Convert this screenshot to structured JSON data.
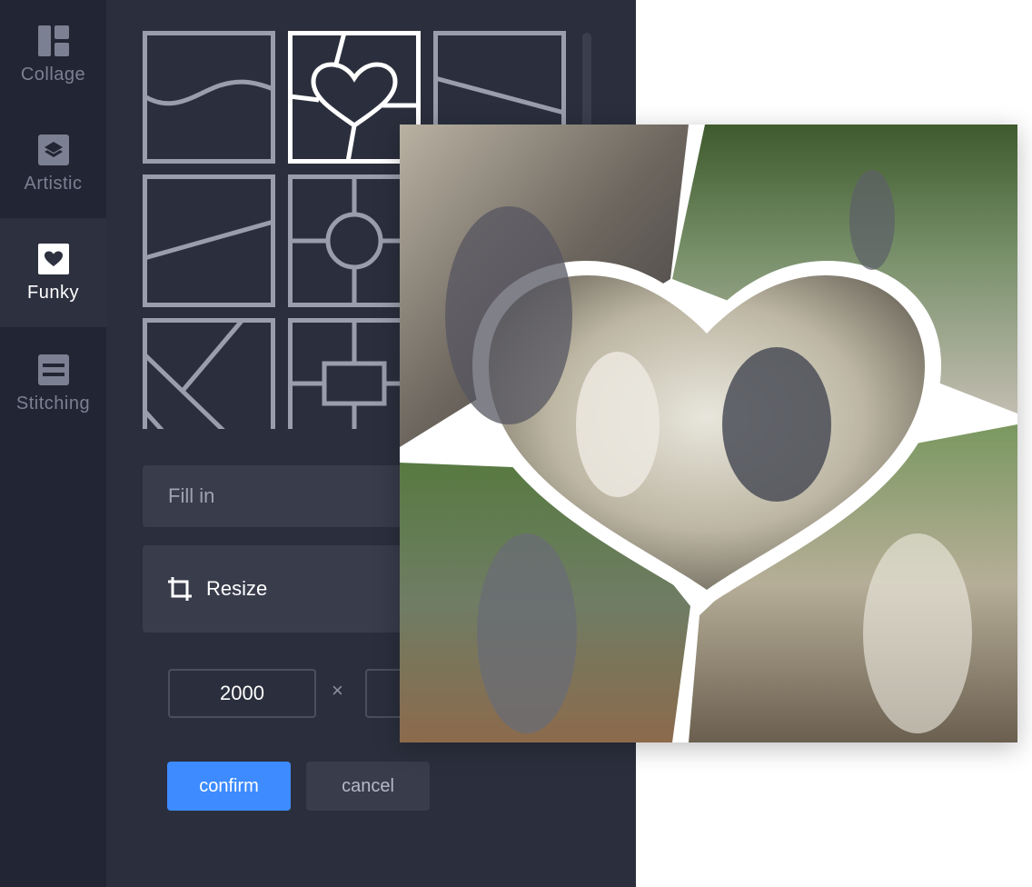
{
  "sidebar": {
    "items": [
      {
        "label": "Collage",
        "icon": "collage-icon"
      },
      {
        "label": "Artistic",
        "icon": "layers-icon"
      },
      {
        "label": "Funky",
        "icon": "heart-icon",
        "active": true
      },
      {
        "label": "Stitching",
        "icon": "stitching-icon"
      }
    ]
  },
  "templates": {
    "selected": "heart-frame",
    "items": [
      "wave-split",
      "heart-frame",
      "diagonal-split",
      "slant-split",
      "circle-center",
      "partial",
      "diamond-diagonal",
      "rect-center",
      "partial"
    ]
  },
  "actions": {
    "fill_label": "Fill in",
    "resize_label": "Resize",
    "confirm_label": "confirm",
    "cancel_label": "cancel"
  },
  "size": {
    "width": "2000",
    "separator": "×"
  },
  "colors": {
    "accent": "#3d8bff",
    "panel": "#2b2f3d",
    "sidebar": "#222533"
  }
}
